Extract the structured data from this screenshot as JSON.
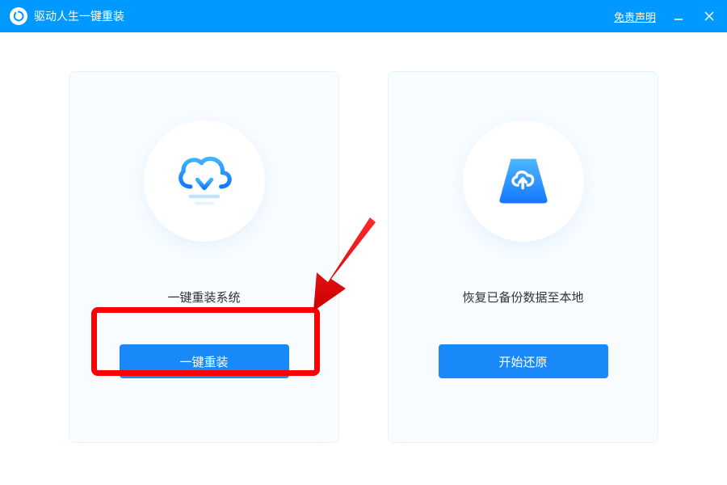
{
  "titlebar": {
    "app_title": "驱动人生一键重装",
    "disclaimer_label": "免责声明"
  },
  "cards": {
    "reinstall": {
      "title": "一键重装系统",
      "button_label": "一键重装",
      "icon_name": "cloud-download-icon"
    },
    "restore": {
      "title": "恢复已备份数据至本地",
      "button_label": "开始还原",
      "icon_name": "drive-upload-icon"
    }
  },
  "colors": {
    "primary": "#0099ff",
    "button": "#1989fa",
    "highlight": "#ff0000"
  }
}
